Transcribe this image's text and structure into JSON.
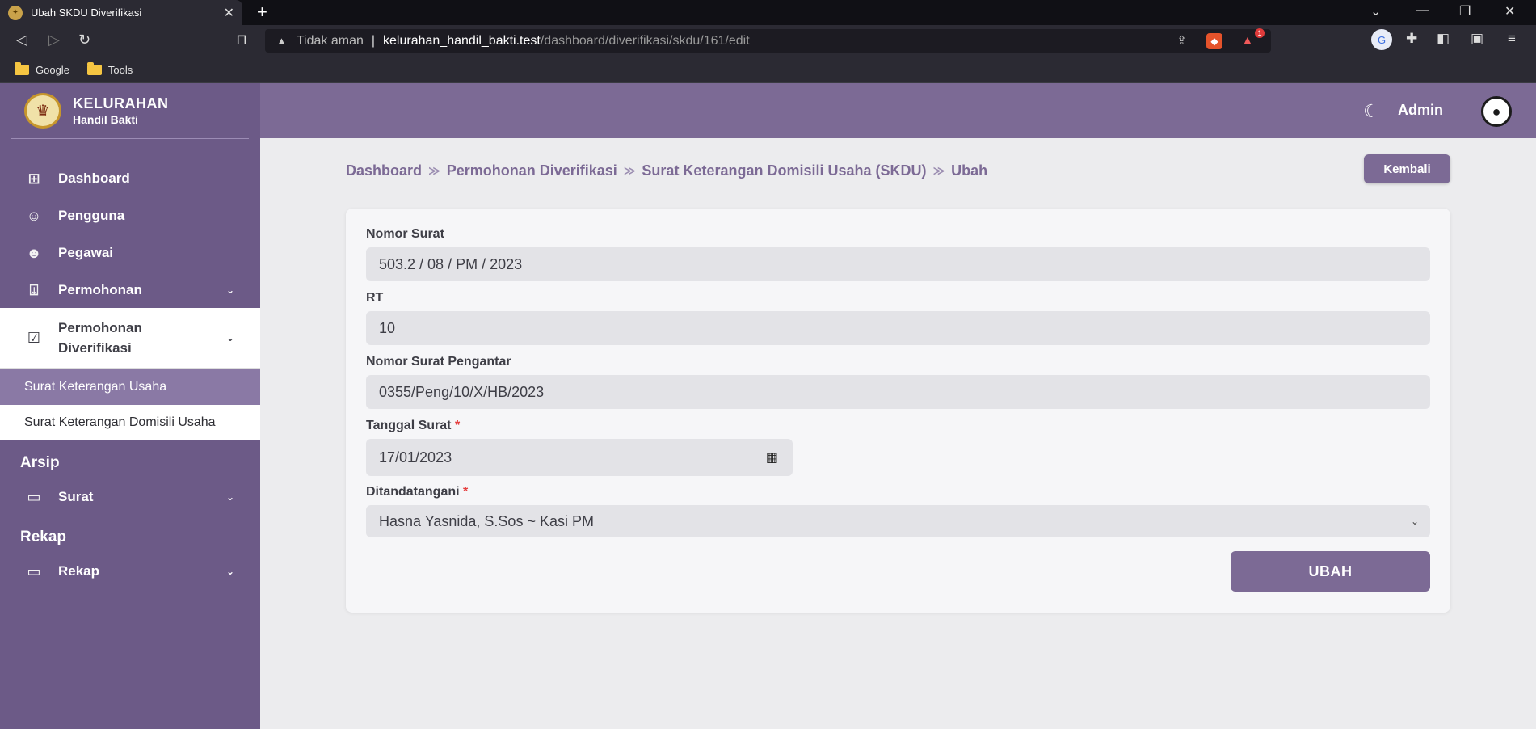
{
  "browser": {
    "tab_title": "Ubah SKDU Diverifikasi",
    "tab_close": "✕",
    "new_tab": "+",
    "security_label": "Tidak aman",
    "url_host": "kelurahan_handil_bakti.test",
    "url_path": "/dashboard/diverifikasi/skdu/161/edit",
    "bookmarks": [
      "Google",
      "Tools"
    ],
    "rewards_badge": "1"
  },
  "brand": {
    "title": "KELURAHAN",
    "subtitle": "Handil Bakti"
  },
  "sidebar": {
    "items": [
      {
        "label": "Dashboard",
        "icon": "grid-icon"
      },
      {
        "label": "Pengguna",
        "icon": "users-outline-icon"
      },
      {
        "label": "Pegawai",
        "icon": "users-icon"
      },
      {
        "label": "Permohonan",
        "icon": "inbox-icon"
      },
      {
        "label": "Permohonan Diverifikasi",
        "icon": "checklist-icon"
      }
    ],
    "subitems": [
      "Surat Keterangan Usaha",
      "Surat Keterangan Domisili Usaha"
    ],
    "section_arsip": "Arsip",
    "arsip_item": "Surat",
    "section_rekap": "Rekap",
    "rekap_item": "Rekap"
  },
  "topbar": {
    "user": "Admin"
  },
  "breadcrumb": [
    "Dashboard",
    "Permohonan Diverifikasi",
    "Surat Keterangan Domisili Usaha (SKDU)",
    "Ubah"
  ],
  "back_button": "Kembali",
  "form": {
    "nomor_surat_label": "Nomor Surat",
    "nomor_surat_value": "503.2 / 08 / PM / 2023",
    "rt_label": "RT",
    "rt_value": "10",
    "pengantar_label": "Nomor Surat Pengantar",
    "pengantar_value": "0355/Peng/10/X/HB/2023",
    "tanggal_label": "Tanggal Surat",
    "tanggal_value": "17/01/2023",
    "ttd_label": "Ditandatangani",
    "ttd_value": "Hasna Yasnida, S.Sos ~ Kasi PM",
    "required_mark": "*",
    "submit_label": "UBAH"
  },
  "colors": {
    "primary": "#7c6a95",
    "sidebar": "#6c5a87",
    "required": "#e53e3e"
  }
}
